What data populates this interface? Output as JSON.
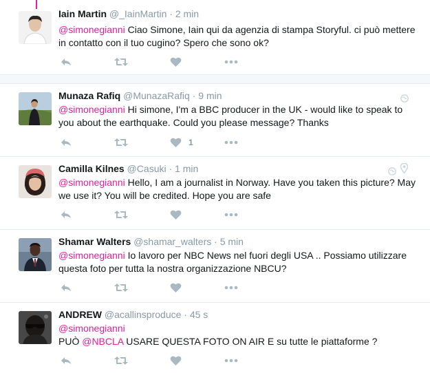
{
  "tweets": [
    {
      "name": "Iain Martin",
      "handle": "@_IainMartin",
      "separator": "·",
      "time": "2 min",
      "mention": "@simonegianni",
      "text": " Ciao Simone, Iain qui da agenzia di stampa Storyful. ci può mettere in contatto con il tuo cugino? Spero che sono ok?",
      "like_count": ""
    },
    {
      "name": "Munaza Rafiq",
      "handle": "@MunazaRafiq",
      "separator": "·",
      "time": "9 min",
      "mention": "@simonegianni",
      "text": " Hi simone, I'm a BBC producer in the UK - would like to speak to you about the earthquake. Could you please message? Thanks",
      "like_count": "1"
    },
    {
      "name": "Camilla Kilnes",
      "handle": "@Casuki",
      "separator": "·",
      "time": "1 min",
      "mention": "@simonegianni",
      "text": " Hello, I am a journalist in Norway. Have you taken this picture? May we use it? You will be credited. Hope you are safe",
      "like_count": ""
    },
    {
      "name": "Shamar Walters",
      "handle": "@shamar_walters",
      "separator": "·",
      "time": "5 min",
      "mention": "@simonegianni",
      "text": " Io lavoro per NBC News nel fuori degli USA .. Possiamo utilizzare questa foto per tutta la nostra organizzazione NBCU?",
      "like_count": ""
    },
    {
      "name": "ANDREW",
      "handle": "@acallinsproduce",
      "separator": "·",
      "time": "45 s",
      "mention": "@simonegianni",
      "line2_prefix": "PUÒ ",
      "mention2": "@NBCLA",
      "line2_rest": " USARE QUESTA FOTO ON AIR E su tutte le piattaforme ?",
      "like_count": ""
    }
  ],
  "icons": {
    "reply": "reply-icon",
    "retweet": "retweet-icon",
    "like": "heart-icon",
    "more": "more-icon",
    "globe": "globe-icon",
    "location": "location-pin-icon"
  },
  "colors": {
    "mention": "#e81c9c",
    "name": "#14171a",
    "meta": "#8899a6",
    "action_icon": "#aab8c2",
    "divider": "#e6ecf0"
  }
}
